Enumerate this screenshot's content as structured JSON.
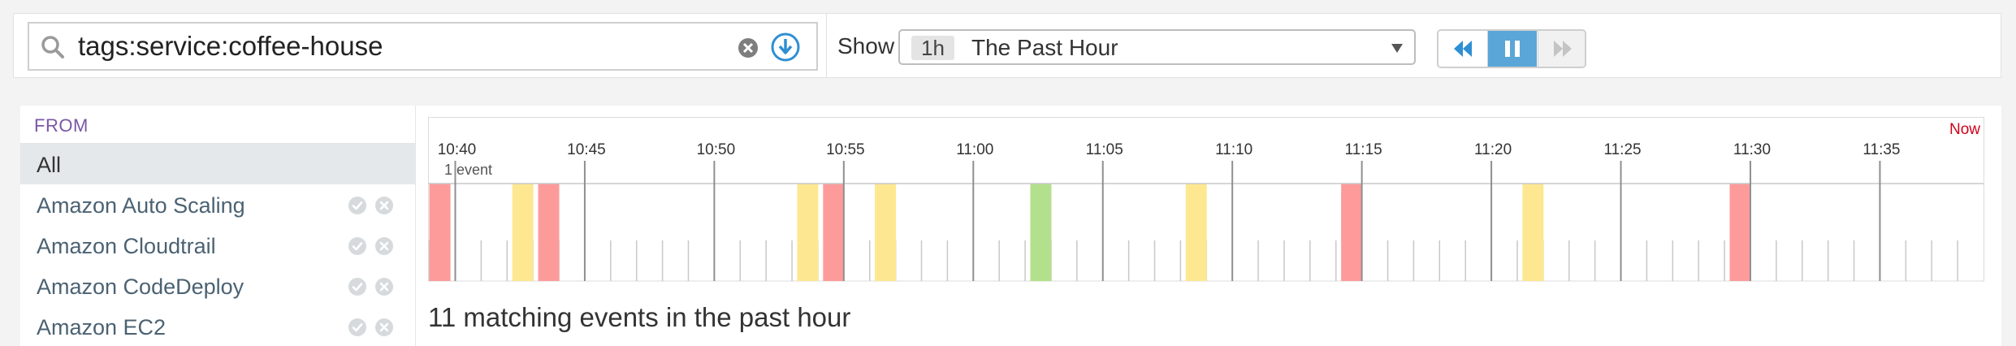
{
  "search": {
    "query": "tags:service:coffee-house",
    "placeholder": ""
  },
  "time_range": {
    "show_label": "Show",
    "badge": "1h",
    "label": "The Past Hour"
  },
  "playback": {
    "buttons": [
      "rewind",
      "pause",
      "fast-forward"
    ],
    "active": "pause"
  },
  "sources": {
    "header": "FROM",
    "items": [
      {
        "label": "All",
        "selected": true
      },
      {
        "label": "Amazon Auto Scaling",
        "selected": false
      },
      {
        "label": "Amazon Cloudtrail",
        "selected": false
      },
      {
        "label": "Amazon CodeDeploy",
        "selected": false
      },
      {
        "label": "Amazon EC2",
        "selected": false
      }
    ]
  },
  "timeline": {
    "scale_label": "1 event",
    "now_label": "Now",
    "ticks": [
      "10:40",
      "10:45",
      "10:50",
      "10:55",
      "11:00",
      "11:05",
      "11:10",
      "11:15",
      "11:20",
      "11:25",
      "11:30",
      "11:35"
    ],
    "start_minute": 38.95,
    "end_minute": 99,
    "events": [
      {
        "minute": 39.0,
        "status": "error"
      },
      {
        "minute": 42.2,
        "status": "warning"
      },
      {
        "minute": 43.2,
        "status": "error"
      },
      {
        "minute": 53.2,
        "status": "warning"
      },
      {
        "minute": 54.2,
        "status": "error"
      },
      {
        "minute": 56.2,
        "status": "warning"
      },
      {
        "minute": 62.2,
        "status": "success"
      },
      {
        "minute": 68.2,
        "status": "warning"
      },
      {
        "minute": 74.2,
        "status": "error"
      },
      {
        "minute": 81.2,
        "status": "warning"
      },
      {
        "minute": 89.2,
        "status": "error"
      }
    ],
    "colors": {
      "error": "#fd9b9b",
      "warning": "#fde891",
      "success": "#b3e08c"
    }
  },
  "summary": "11 matching events in the past hour"
}
